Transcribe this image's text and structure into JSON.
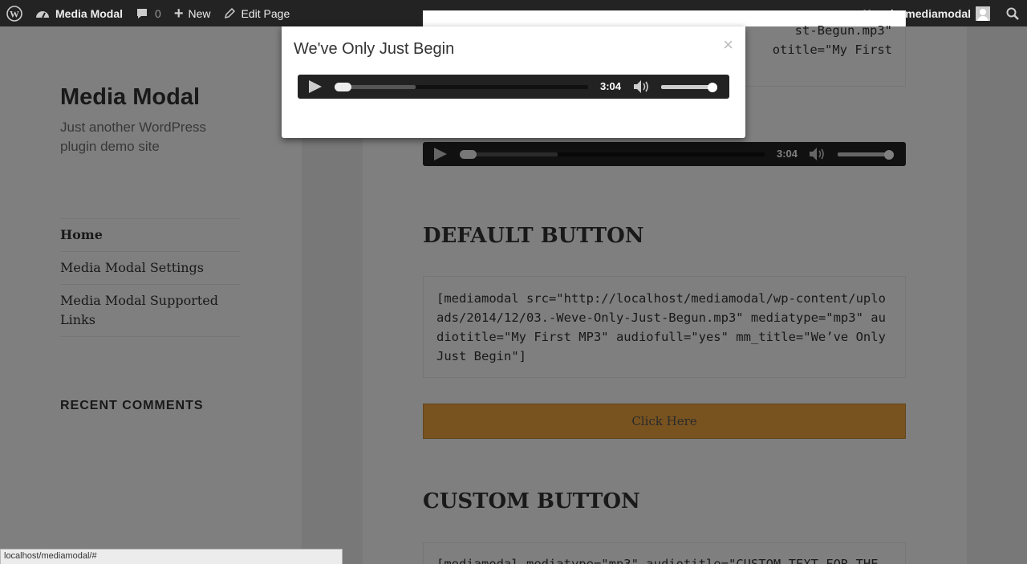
{
  "admin_bar": {
    "site_name": "Media Modal",
    "comments_count": "0",
    "new_label": "New",
    "edit_label": "Edit Page",
    "howdy": "Howdy, mediamodal"
  },
  "sidebar": {
    "site_title": "Media Modal",
    "site_description": "Just another WordPress plugin demo site",
    "nav": [
      {
        "label": "Home"
      },
      {
        "label": "Media Modal Settings"
      },
      {
        "label": "Media Modal Supported Links"
      }
    ],
    "widget_title": "RECENT COMMENTS"
  },
  "content": {
    "player_time": "3:04",
    "default_heading": "DEFAULT BUTTON",
    "default_code": "[mediamodal src=\"http://localhost/mediamodal/wp-content/uploads/2014/12/03.-Weve-Only-Just-Begun.mp3\" mediatype=\"mp3\" audiotitle=\"My First MP3\" audiofull=\"yes\" mm_title=\"We’ve Only Just Begin\"]",
    "button_label": "Click Here",
    "custom_heading": "CUSTOM BUTTON",
    "custom_code": "[mediamodal mediatype=\"mp3\" audiotitle=\"CUSTOM TEXT FOR THE",
    "top_code": "st-Begun.mp3\"\n otitle=\"My First"
  },
  "modal": {
    "title": "We've Only Just Begin",
    "close": "×",
    "player_time": "3:04",
    "progress": 0.0,
    "loaded": 0.32,
    "volume": 1.0
  },
  "status_bar": {
    "url": "localhost/mediamodal/#"
  },
  "colors": {
    "admin_bar": "#232323",
    "button": "#f1a741",
    "player": "#222222"
  }
}
